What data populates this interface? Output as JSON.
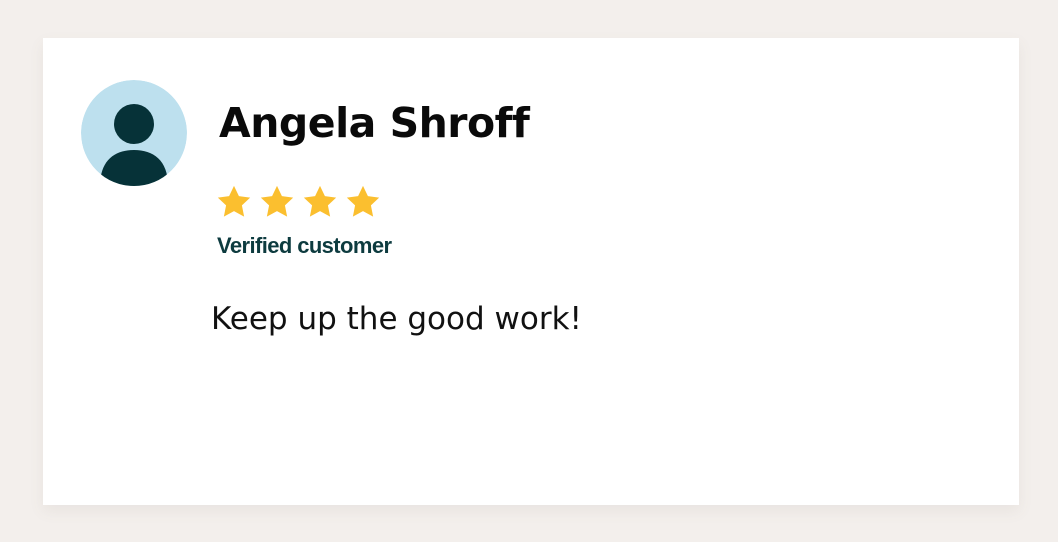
{
  "review": {
    "reviewer_name": "Angela Shroff",
    "avatar_icon": "user-silhouette-icon",
    "rating": 4,
    "rating_max": 4,
    "status": "Verified customer",
    "text": "Keep up the good work!"
  },
  "colors": {
    "page_background": "#f3efec",
    "card_background": "#ffffff",
    "avatar_background": "#bde0ee",
    "avatar_figure": "#063238",
    "star": "#fbbf2f",
    "verified_text": "#0d3b3f"
  }
}
